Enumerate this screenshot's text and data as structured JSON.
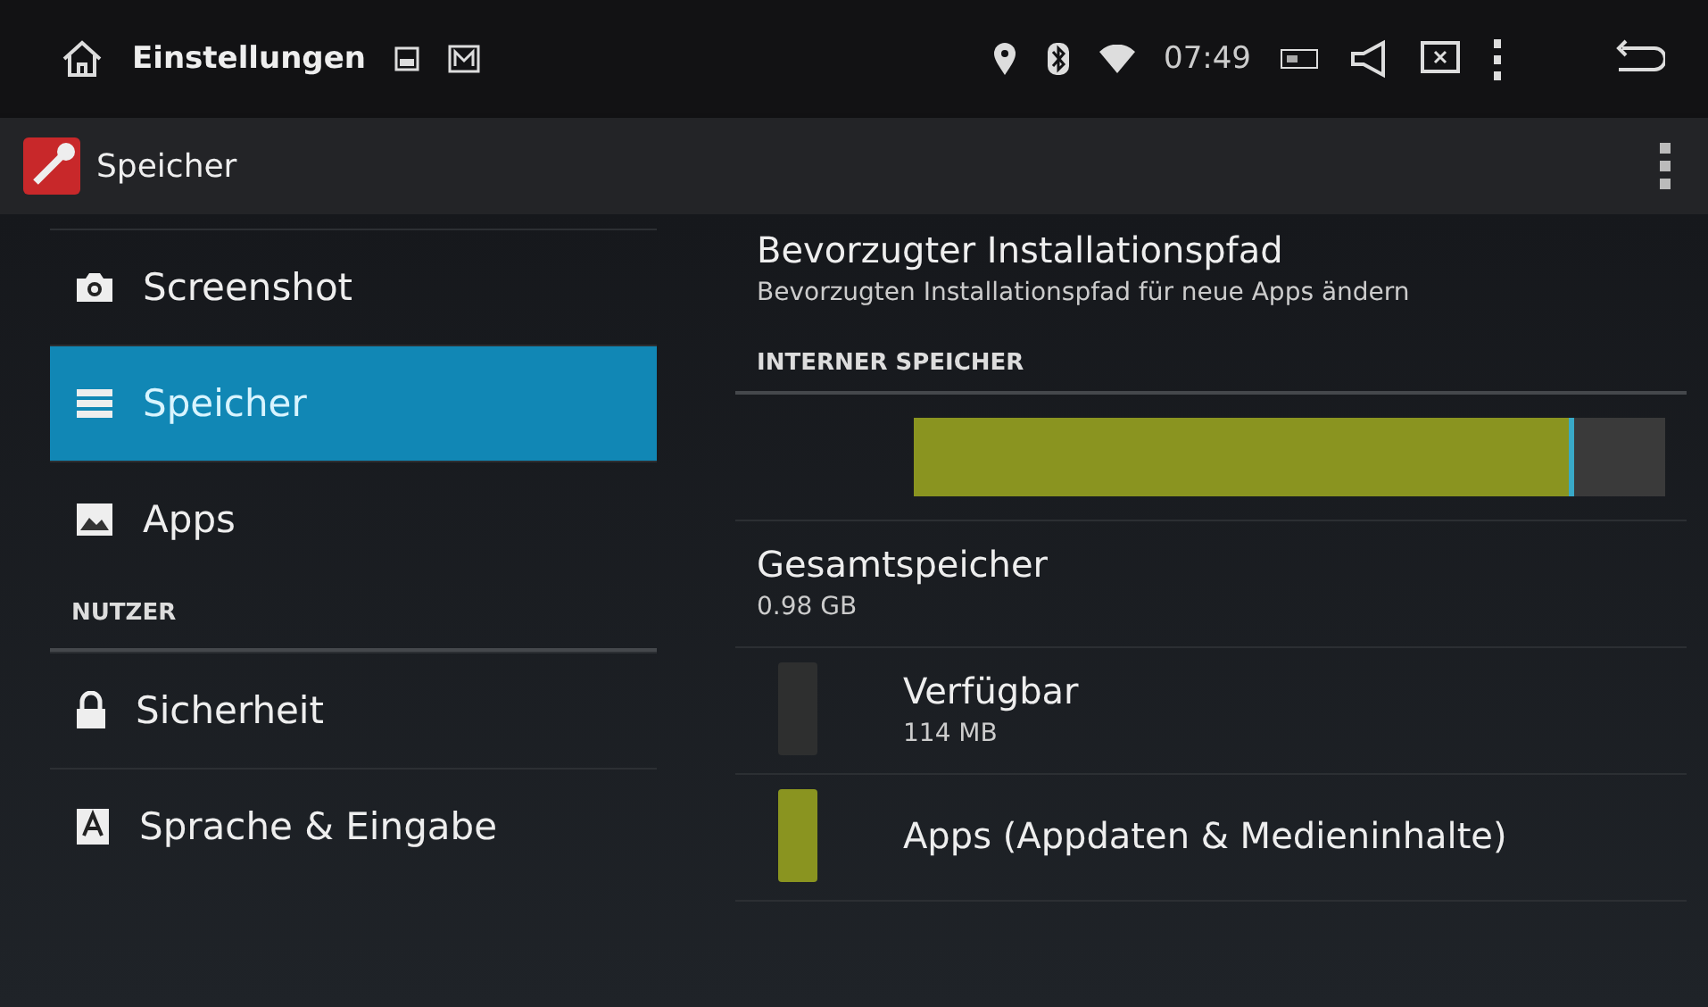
{
  "status_bar": {
    "title": "Einstellungen",
    "time": "07:49"
  },
  "action_bar": {
    "title": "Speicher"
  },
  "sidebar": {
    "items": [
      {
        "kind": "item",
        "label": "Screenshot",
        "selected": false
      },
      {
        "kind": "item",
        "label": "Speicher",
        "selected": true
      },
      {
        "kind": "item",
        "label": "Apps",
        "selected": false
      },
      {
        "kind": "header",
        "label": "NUTZER"
      },
      {
        "kind": "item",
        "label": "Sicherheit",
        "selected": false
      },
      {
        "kind": "item",
        "label": "Sprache & Eingabe",
        "selected": false
      }
    ]
  },
  "content": {
    "preference": {
      "title": "Bevorzugter Installationspfad",
      "summary": "Bevorzugten Installationspfad für neue Apps ändern"
    },
    "section": "INTERNER SPEICHER",
    "storage_bar": {
      "level": 0.88
    },
    "total": {
      "title": "Gesamtspeicher",
      "value": "0.98 GB"
    },
    "legend": [
      {
        "title": "Verfügbar",
        "value": "114 MB",
        "color": "#2e2f2f"
      },
      {
        "title": "Apps (Appdaten & Medieninhalte)",
        "color": "#8a9420"
      }
    ]
  }
}
